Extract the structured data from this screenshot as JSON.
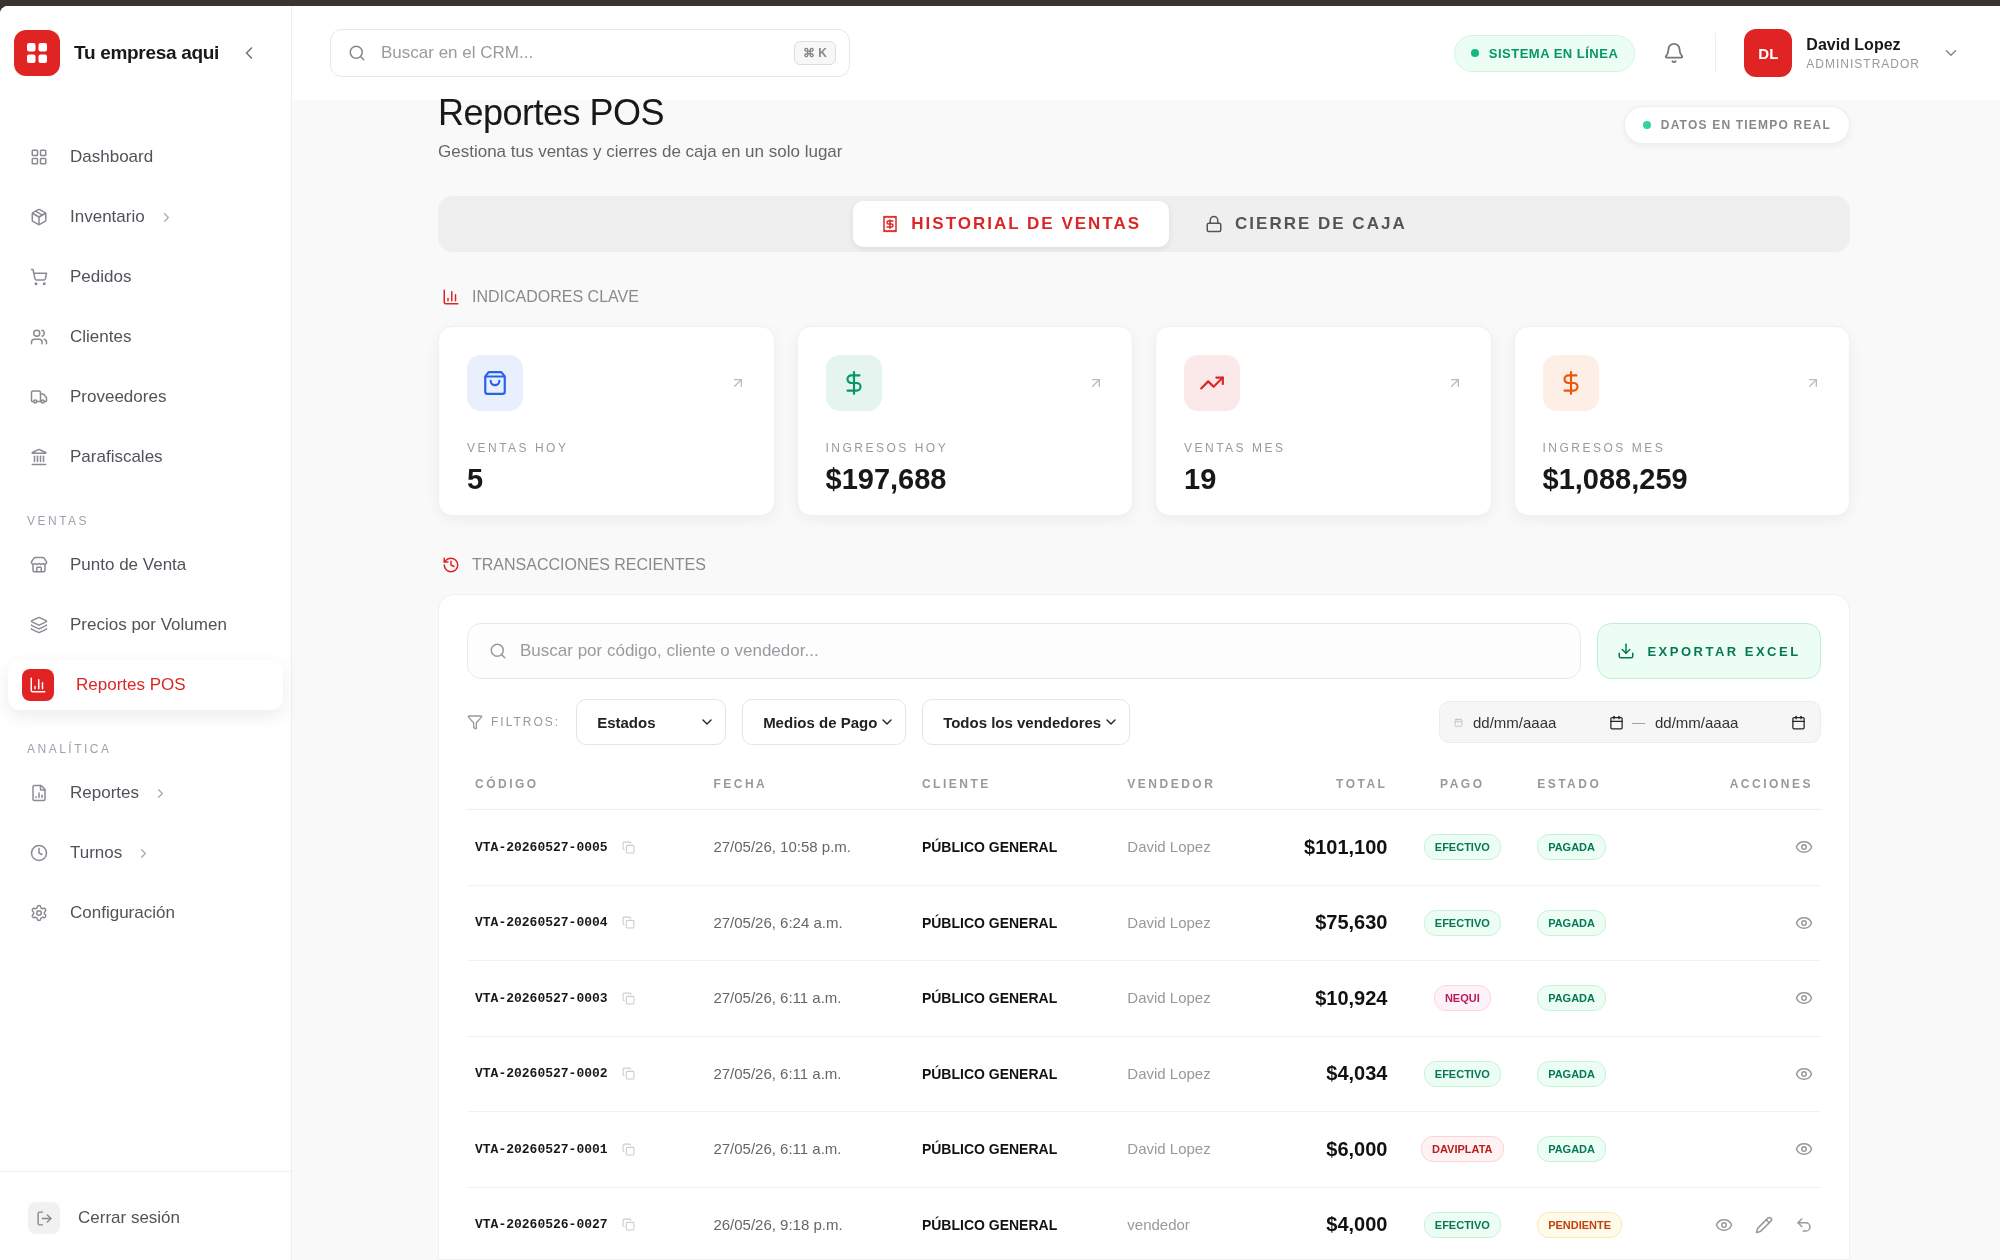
{
  "brand": {
    "name": "Tu empresa aqui"
  },
  "search": {
    "placeholder": "Buscar en el CRM...",
    "shortcut": "⌘ K"
  },
  "status": {
    "label": "SISTEMA EN LÍNEA"
  },
  "user": {
    "initials": "DL",
    "name": "David Lopez",
    "role": "ADMINISTRADOR"
  },
  "sidebar": {
    "groups": [
      {
        "items": [
          {
            "label": "Dashboard",
            "has_submenu": false,
            "selected": false
          },
          {
            "label": "Inventario",
            "has_submenu": true,
            "selected": false
          },
          {
            "label": "Pedidos",
            "has_submenu": false,
            "selected": false
          },
          {
            "label": "Clientes",
            "has_submenu": false,
            "selected": false
          },
          {
            "label": "Proveedores",
            "has_submenu": false,
            "selected": false
          },
          {
            "label": "Parafiscales",
            "has_submenu": false,
            "selected": false
          }
        ]
      },
      {
        "heading": "VENTAS",
        "items": [
          {
            "label": "Punto de Venta",
            "has_submenu": false,
            "selected": false
          },
          {
            "label": "Precios por Volumen",
            "has_submenu": false,
            "selected": false
          },
          {
            "label": "Reportes POS",
            "has_submenu": false,
            "selected": true
          }
        ]
      },
      {
        "heading": "ANALÍTICA",
        "items": [
          {
            "label": "Reportes",
            "has_submenu": true,
            "selected": false
          },
          {
            "label": "Turnos",
            "has_submenu": true,
            "selected": false
          },
          {
            "label": "Configuración",
            "has_submenu": false,
            "selected": false
          }
        ]
      }
    ],
    "logout": "Cerrar sesión"
  },
  "page": {
    "title": "Reportes POS",
    "subtitle": "Gestiona tus ventas y cierres de caja en un solo lugar",
    "live_badge": "DATOS EN TIEMPO REAL"
  },
  "tabs": [
    {
      "label": "HISTORIAL DE VENTAS",
      "selected": true
    },
    {
      "label": "CIERRE DE CAJA",
      "selected": false
    }
  ],
  "kpi_section": {
    "title": "INDICADORES CLAVE"
  },
  "kpis": [
    {
      "label": "VENTAS HOY",
      "value": "5",
      "color": "#2563eb"
    },
    {
      "label": "INGRESOS HOY",
      "value": "$197,688",
      "color": "#059669"
    },
    {
      "label": "VENTAS MES",
      "value": "19",
      "color": "#dc2626"
    },
    {
      "label": "INGRESOS MES",
      "value": "$1,088,259",
      "color": "#ea580c"
    }
  ],
  "transactions": {
    "title": "TRANSACCIONES RECIENTES",
    "search_placeholder": "Buscar por código, cliente o vendedor...",
    "export_button": "EXPORTAR EXCEL",
    "filters_label": "FILTROS:",
    "filters": [
      "Estados",
      "Medios de Pago",
      "Todos los vendedores"
    ],
    "date_from": {
      "placeholder": "dd/mm/aaaa"
    },
    "date_separator": "—",
    "date_to": {
      "placeholder": "dd/mm/aaaa"
    },
    "columns": [
      "CÓDIGO",
      "FECHA",
      "CLIENTE",
      "VENDEDOR",
      "TOTAL",
      "PAGO",
      "ESTADO",
      "ACCIONES"
    ],
    "rows": [
      {
        "code": "VTA-20260527-0005",
        "date": "27/05/26, 10:58 p.m.",
        "client": "PÚBLICO GENERAL",
        "seller": "David Lopez",
        "total": "$101,100",
        "payment": {
          "label": "EFECTIVO",
          "kind": "cash"
        },
        "status": {
          "label": "PAGADA",
          "kind": "paid"
        },
        "editable": false
      },
      {
        "code": "VTA-20260527-0004",
        "date": "27/05/26, 6:24 a.m.",
        "client": "PÚBLICO GENERAL",
        "seller": "David Lopez",
        "total": "$75,630",
        "payment": {
          "label": "EFECTIVO",
          "kind": "cash"
        },
        "status": {
          "label": "PAGADA",
          "kind": "paid"
        },
        "editable": false
      },
      {
        "code": "VTA-20260527-0003",
        "date": "27/05/26, 6:11 a.m.",
        "client": "PÚBLICO GENERAL",
        "seller": "David Lopez",
        "total": "$10,924",
        "payment": {
          "label": "NEQUI",
          "kind": "nequi"
        },
        "status": {
          "label": "PAGADA",
          "kind": "paid"
        },
        "editable": false
      },
      {
        "code": "VTA-20260527-0002",
        "date": "27/05/26, 6:11 a.m.",
        "client": "PÚBLICO GENERAL",
        "seller": "David Lopez",
        "total": "$4,034",
        "payment": {
          "label": "EFECTIVO",
          "kind": "cash"
        },
        "status": {
          "label": "PAGADA",
          "kind": "paid"
        },
        "editable": false
      },
      {
        "code": "VTA-20260527-0001",
        "date": "27/05/26, 6:11 a.m.",
        "client": "PÚBLICO GENERAL",
        "seller": "David Lopez",
        "total": "$6,000",
        "payment": {
          "label": "DAVIPLATA",
          "kind": "daviplata"
        },
        "status": {
          "label": "PAGADA",
          "kind": "paid"
        },
        "editable": false
      },
      {
        "code": "VTA-20260526-0027",
        "date": "26/05/26, 9:18 p.m.",
        "client": "PÚBLICO GENERAL",
        "seller": "vendedor",
        "total": "$4,000",
        "payment": {
          "label": "EFECTIVO",
          "kind": "cash"
        },
        "status": {
          "label": "PENDIENTE",
          "kind": "pending"
        },
        "editable": true
      }
    ]
  }
}
